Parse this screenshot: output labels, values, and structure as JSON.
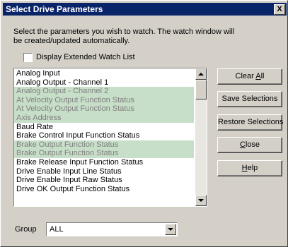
{
  "window": {
    "title": "Select Drive Parameters",
    "close_glyph": "X"
  },
  "instructions": "Select the parameters you wish to watch.  The watch window will be created/updated automatically.",
  "extended_watch": {
    "label": "Display Extended Watch List",
    "checked": false
  },
  "list": {
    "items": [
      {
        "label": "Analog Input",
        "selected": false
      },
      {
        "label": "Analog Output - Channel 1",
        "selected": false
      },
      {
        "label": "Analog Output - Channel 2",
        "selected": true
      },
      {
        "label": "At Velocity Output Function Status",
        "selected": true
      },
      {
        "label": "At Velocity Output Function Status",
        "selected": true
      },
      {
        "label": "Axis Address",
        "selected": true
      },
      {
        "label": "Baud Rate",
        "selected": false
      },
      {
        "label": "Brake Control Input Function Status",
        "selected": false
      },
      {
        "label": "Brake Output Function Status",
        "selected": true
      },
      {
        "label": "Brake Output Function Status",
        "selected": true
      },
      {
        "label": "Brake Release Input Function Status",
        "selected": false
      },
      {
        "label": "Drive Enable Input Line Status",
        "selected": false
      },
      {
        "label": "Drive Enable Input Raw Status",
        "selected": false
      },
      {
        "label": "Drive OK Output Function Status",
        "selected": false
      }
    ]
  },
  "buttons": {
    "clear_all": {
      "pre": "Clear ",
      "accel": "A",
      "post": "ll"
    },
    "save_selections": "Save Selections",
    "restore_selections": "Restore Selections",
    "close": {
      "pre": "",
      "accel": "C",
      "post": "lose"
    },
    "help": {
      "pre": "",
      "accel": "H",
      "post": "elp"
    }
  },
  "group": {
    "label": "Group",
    "value": "ALL"
  },
  "colors": {
    "titlebar": "#0a246a",
    "selection_bg": "#c7dec8",
    "dialog_bg": "#d4d0c8"
  }
}
